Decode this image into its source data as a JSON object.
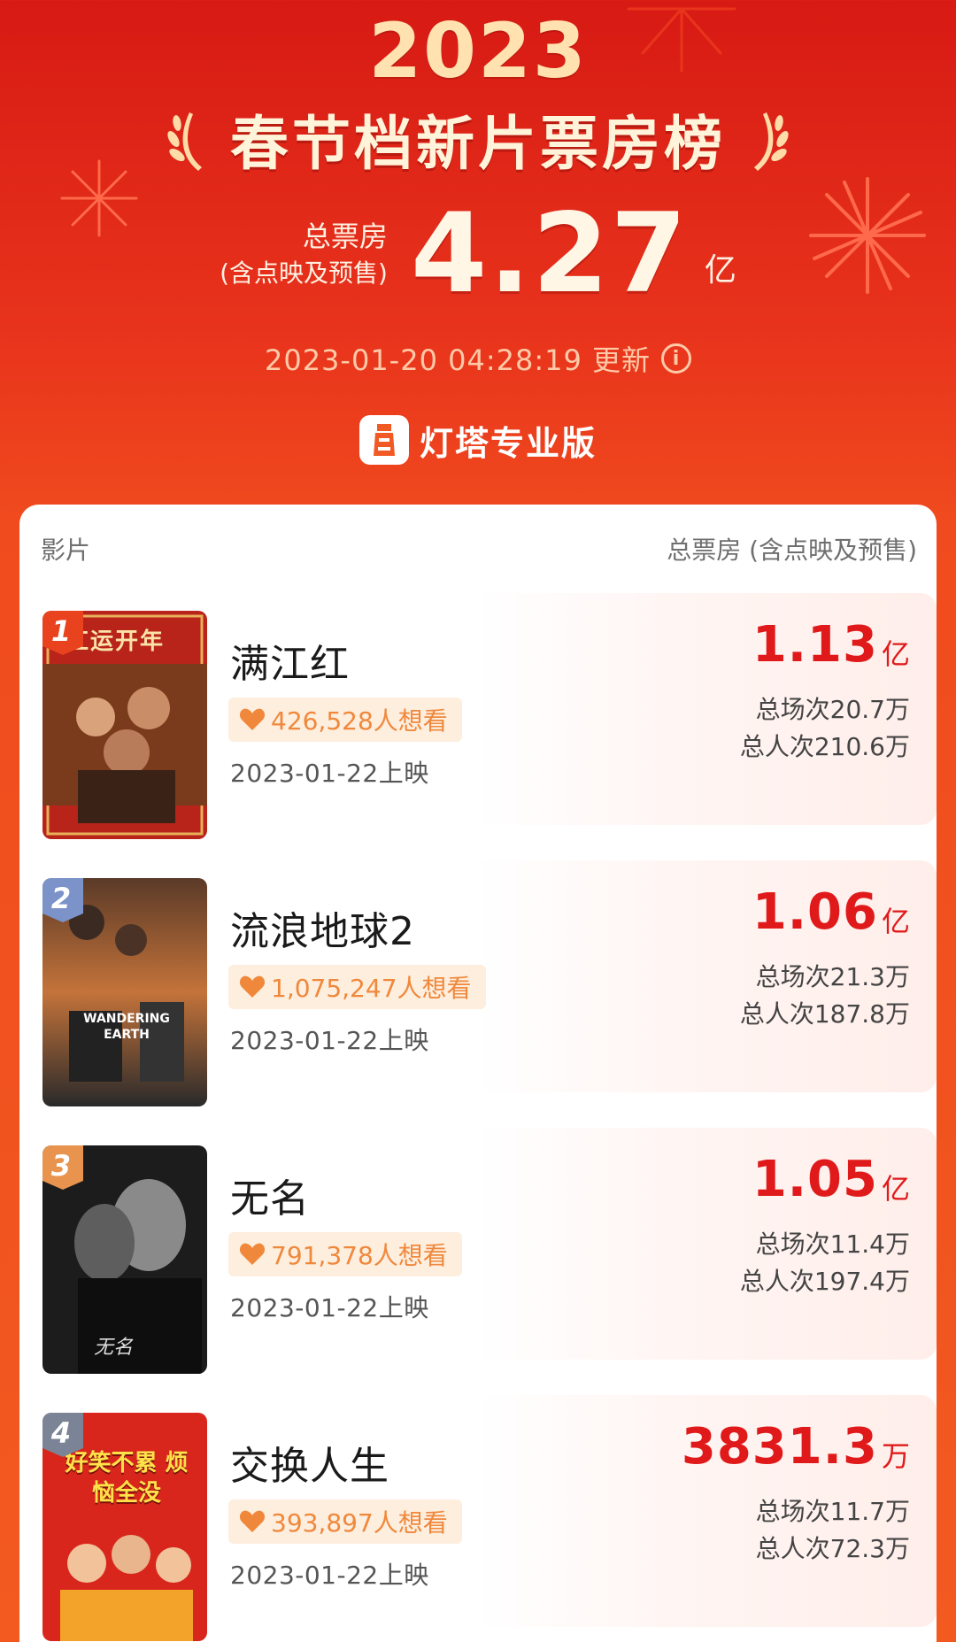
{
  "header": {
    "year": "2023",
    "title": "春节档新片票房榜",
    "total_label_line1": "总票房",
    "total_label_line2": "(含点映及预售)",
    "total_value": "4.27",
    "total_unit": "亿",
    "updated": "2023-01-20 04:28:19 更新",
    "brand": "灯塔专业版",
    "colors": {
      "background": "#e8331c",
      "title": "#fff3da",
      "year": "#ffe2b0"
    }
  },
  "table": {
    "col_film": "影片",
    "col_box": "总票房 (含点映及预售)",
    "movies": [
      {
        "rank": "1",
        "name": "满江红",
        "want": "426,528人想看",
        "release": "2023-01-22上映",
        "box": "1.13",
        "unit": "亿",
        "shows": "总场次20.7万",
        "viewers": "总人次210.6万",
        "rank_color": "#e8421e",
        "poster_text": "红运开年"
      },
      {
        "rank": "2",
        "name": "流浪地球2",
        "want": "1,075,247人想看",
        "release": "2023-01-22上映",
        "box": "1.06",
        "unit": "亿",
        "shows": "总场次21.3万",
        "viewers": "总人次187.8万",
        "rank_color": "#7c93c9",
        "poster_text": "WANDERING EARTH"
      },
      {
        "rank": "3",
        "name": "无名",
        "want": "791,378人想看",
        "release": "2023-01-22上映",
        "box": "1.05",
        "unit": "亿",
        "shows": "总场次11.4万",
        "viewers": "总人次197.4万",
        "rank_color": "#e8944e",
        "poster_text": "无名"
      },
      {
        "rank": "4",
        "name": "交换人生",
        "want": "393,897人想看",
        "release": "2023-01-22上映",
        "box": "3831.3",
        "unit": "万",
        "shows": "总场次11.7万",
        "viewers": "总人次72.3万",
        "rank_color": "#7a8496",
        "poster_text": "好笑不累 烦恼全没"
      }
    ]
  },
  "colors": {
    "box_value": "#e01a1a",
    "want_text": "#f0883c",
    "want_bg": "#fdeede"
  }
}
